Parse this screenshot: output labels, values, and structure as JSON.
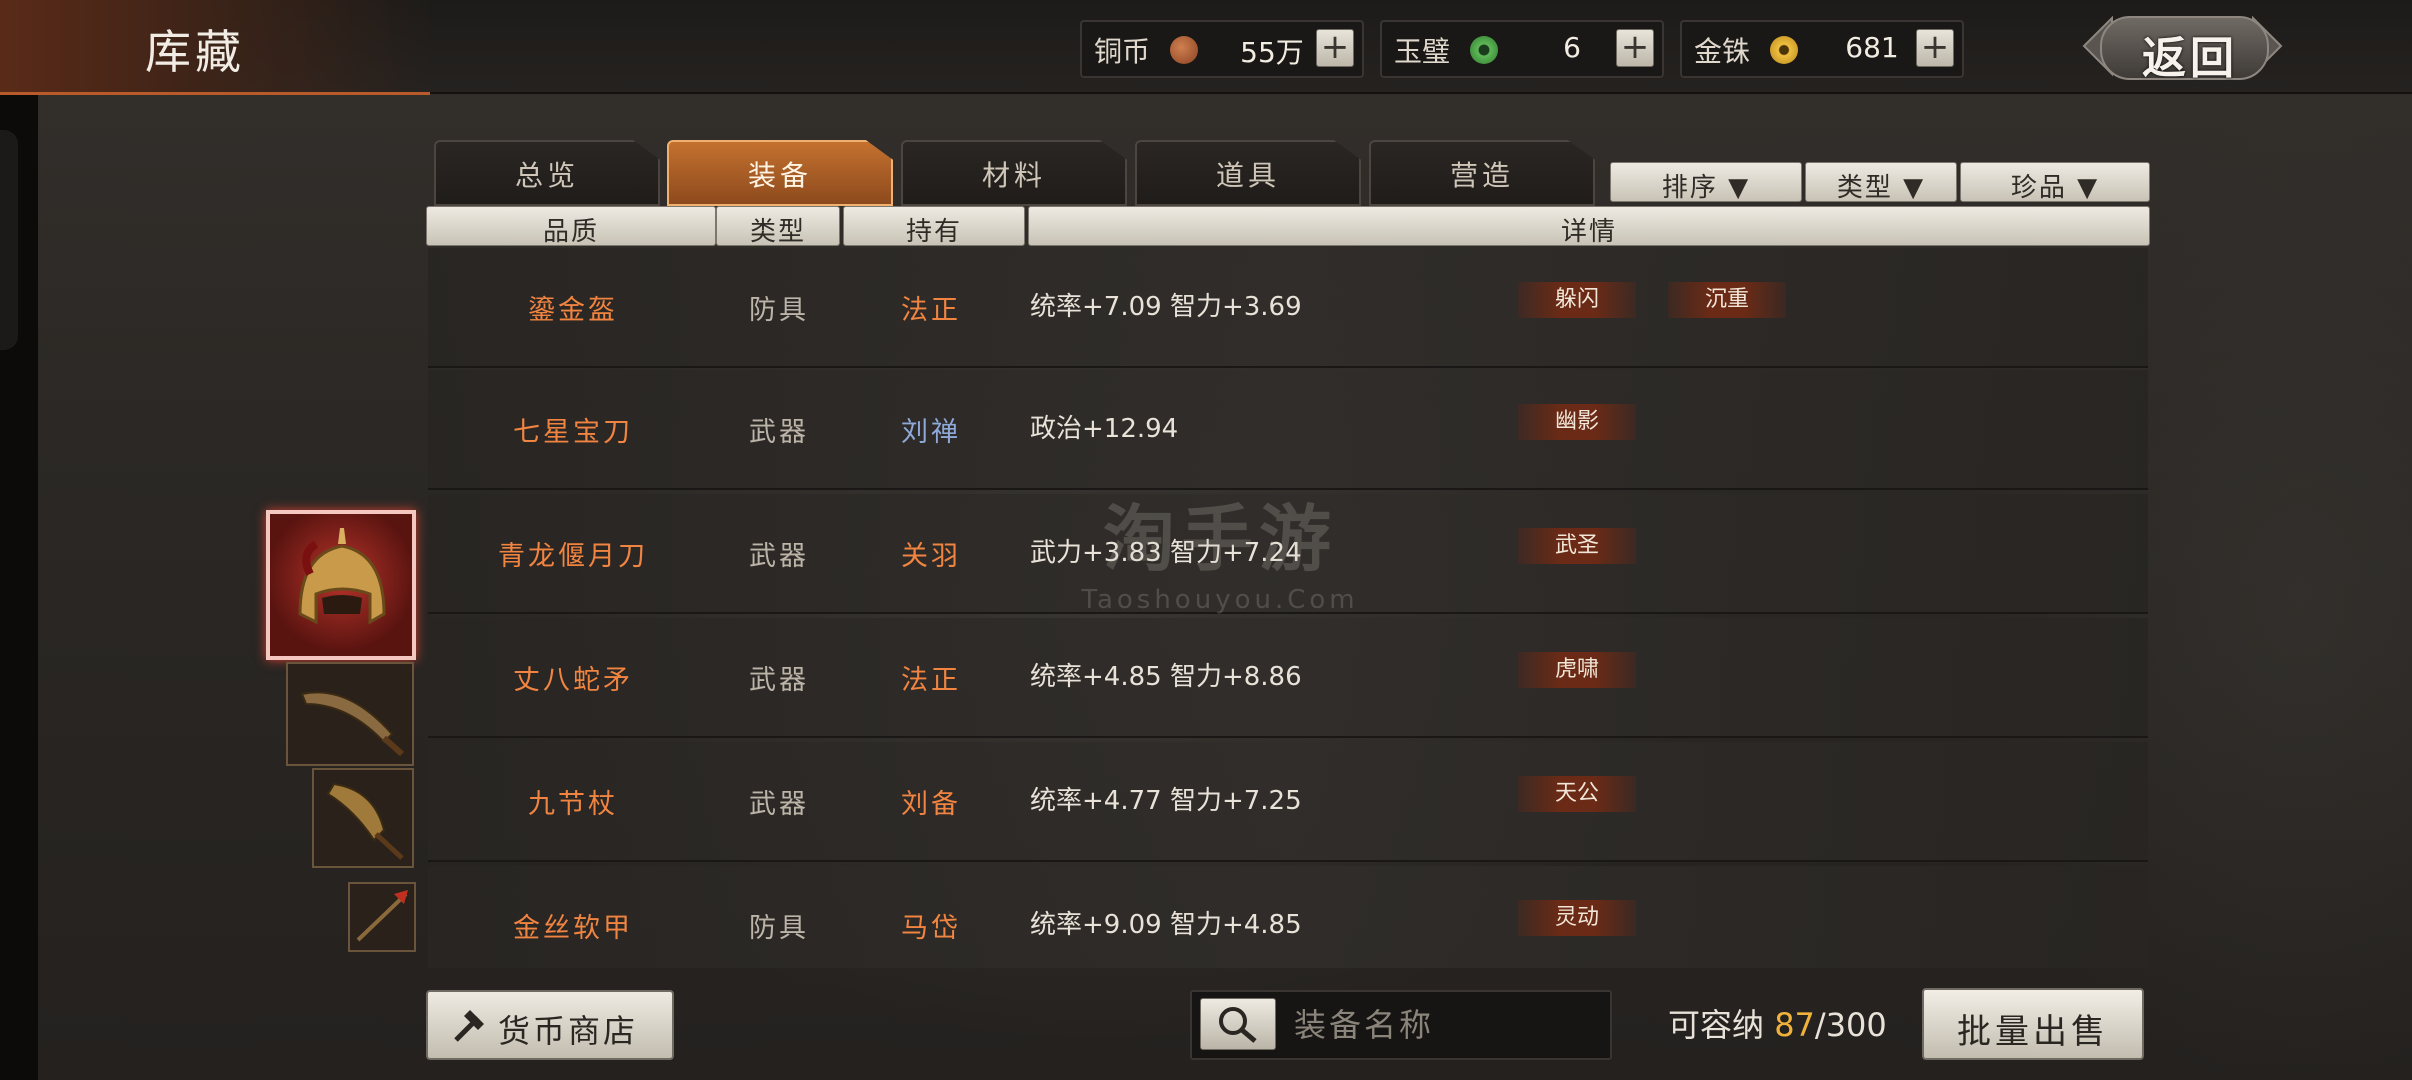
{
  "header": {
    "title": "库藏",
    "back_label": "返回"
  },
  "currencies": [
    {
      "label": "铜币",
      "value": "55万",
      "coin_color": "#a0552e"
    },
    {
      "label": "玉璧",
      "value": "6",
      "coin_color": "#4fa04a"
    },
    {
      "label": "金铢",
      "value": "681",
      "coin_color": "#d4a12a"
    }
  ],
  "tabs": [
    {
      "label": "总览",
      "active": false
    },
    {
      "label": "装备",
      "active": true
    },
    {
      "label": "材料",
      "active": false
    },
    {
      "label": "道具",
      "active": false
    },
    {
      "label": "营造",
      "active": false
    }
  ],
  "filters": {
    "sort": "排序 ▼",
    "type": "类型 ▼",
    "rarity": "珍品 ▼"
  },
  "columns": {
    "quality": "品质",
    "type": "类型",
    "owner": "持有",
    "detail": "详情"
  },
  "rows": [
    {
      "name": "鎏金盔",
      "type": "防具",
      "owner": "法正",
      "owner_color": "orange",
      "stats": "统率+7.09  智力+3.69",
      "tags": [
        "躲闪",
        "沉重"
      ]
    },
    {
      "name": "七星宝刀",
      "type": "武器",
      "owner": "刘禅",
      "owner_color": "blue",
      "stats": "政治+12.94",
      "tags": [
        "幽影"
      ]
    },
    {
      "name": "青龙偃月刀",
      "type": "武器",
      "owner": "关羽",
      "owner_color": "orange",
      "stats": "武力+3.83  智力+7.24",
      "tags": [
        "武圣"
      ]
    },
    {
      "name": "丈八蛇矛",
      "type": "武器",
      "owner": "法正",
      "owner_color": "orange",
      "stats": "统率+4.85  智力+8.86",
      "tags": [
        "虎啸"
      ]
    },
    {
      "name": "九节杖",
      "type": "武器",
      "owner": "刘备",
      "owner_color": "orange",
      "stats": "统率+4.77  智力+7.25",
      "tags": [
        "天公"
      ]
    },
    {
      "name": "金丝软甲",
      "type": "防具",
      "owner": "马岱",
      "owner_color": "orange",
      "stats": "统率+9.09  智力+4.85",
      "tags": [
        "灵动"
      ]
    }
  ],
  "footer": {
    "shop_label": "货币商店",
    "search_placeholder": "装备名称",
    "capacity_label": "可容纳",
    "capacity_used": "87",
    "capacity_total": "/300",
    "sell_label": "批量出售"
  },
  "watermark": {
    "cn": "淘手游",
    "en": "Taoshouyou.Com"
  }
}
